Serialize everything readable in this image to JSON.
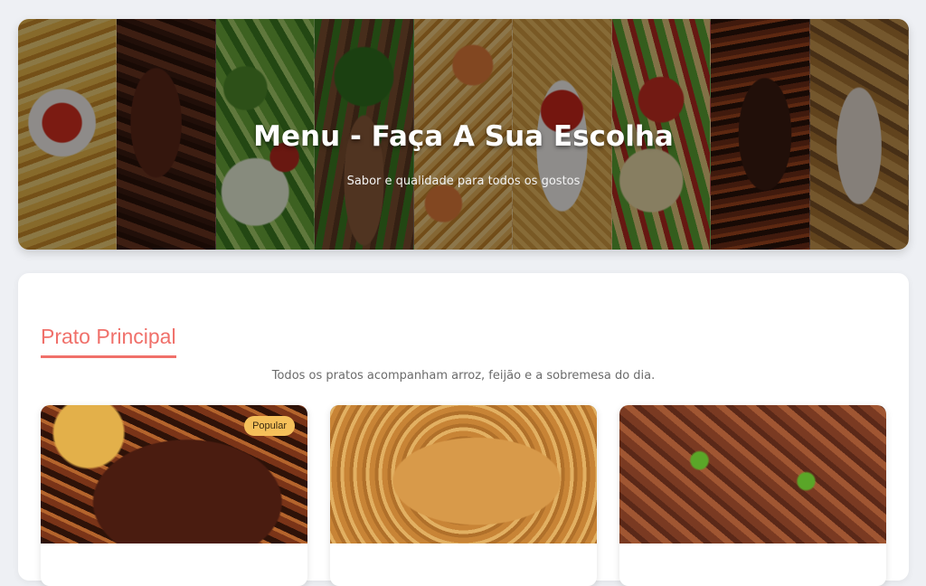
{
  "hero": {
    "title": "Menu - Faça A Sua Escolha",
    "subtitle": "Sabor e qualidade para todos os gostos"
  },
  "section": {
    "title": "Prato Principal",
    "description": "Todos os pratos acompanham arroz, feijão e a sobremesa do dia."
  },
  "dishes": [
    {
      "image": "steak-photo",
      "badge": "Popular"
    },
    {
      "image": "fried-chicken-photo"
    },
    {
      "image": "beef-stew-photo"
    }
  ],
  "colors": {
    "accent": "#f0706a",
    "badge": "#f5c05a",
    "background": "#eef0f4"
  }
}
